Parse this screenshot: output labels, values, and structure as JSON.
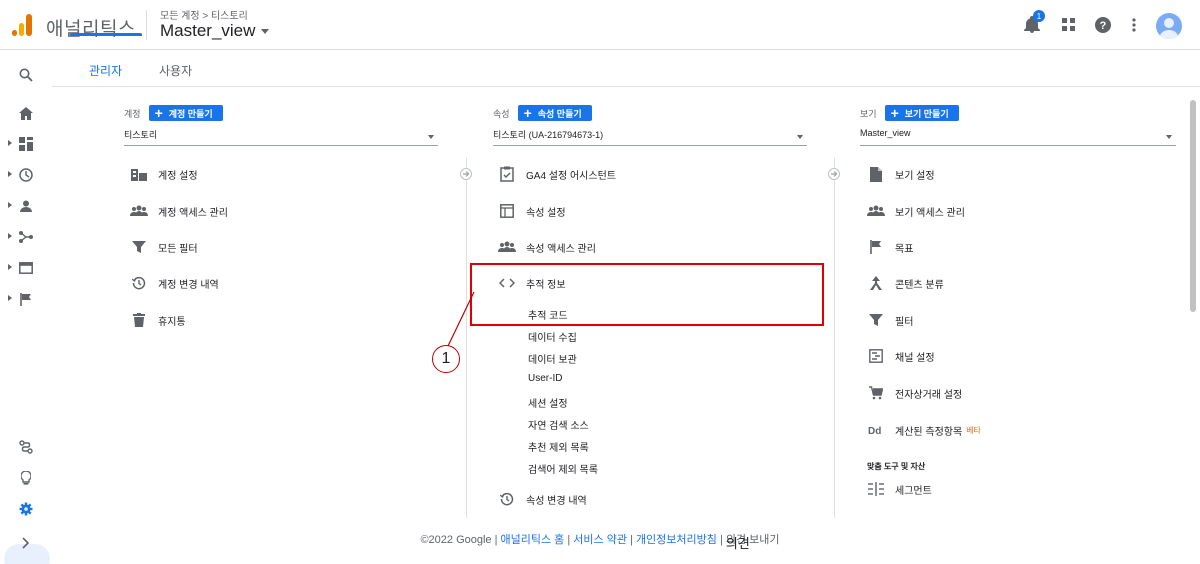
{
  "header": {
    "app_name": "애널리틱스",
    "breadcrumb": "모든 계정 > 티스토리",
    "view_name": "Master_view",
    "notification_count": "1"
  },
  "tabs": [
    {
      "label": "관리자",
      "active": true
    },
    {
      "label": "사용자",
      "active": false
    }
  ],
  "account_col": {
    "label": "계정",
    "create_label": "계정 만들기",
    "dropdown_value": "티스토리",
    "items": [
      {
        "label": "계정 설정",
        "icon": "building-icon"
      },
      {
        "label": "계정 액세스 관리",
        "icon": "people-icon"
      },
      {
        "label": "모든 필터",
        "icon": "filter-icon"
      },
      {
        "label": "계정 변경 내역",
        "icon": "history-icon"
      },
      {
        "label": "휴지통",
        "icon": "trash-icon"
      }
    ]
  },
  "property_col": {
    "label": "속성",
    "create_label": "속성 만들기",
    "dropdown_value": "티스토리 (UA-216794673-1)",
    "items": [
      {
        "label": "GA4 설정 어시스턴트",
        "icon": "checklist-icon"
      },
      {
        "label": "속성 설정",
        "icon": "layout-icon"
      },
      {
        "label": "속성 액세스 관리",
        "icon": "people-icon"
      },
      {
        "label": "추적 정보",
        "icon": "code-icon"
      }
    ],
    "tracking_sub": [
      "추적 코드",
      "데이터 수집",
      "데이터 보관",
      "User-ID",
      "세션 설정",
      "자연 검색 소스",
      "추천 제외 목록",
      "검색어 제외 목록"
    ],
    "change_history": "속성 변경 내역"
  },
  "view_col": {
    "label": "보기",
    "create_label": "보기 만들기",
    "dropdown_value": "Master_view",
    "items": [
      {
        "label": "보기 설정",
        "icon": "document-icon"
      },
      {
        "label": "보기 액세스 관리",
        "icon": "people-icon"
      },
      {
        "label": "목표",
        "icon": "flag-icon"
      },
      {
        "label": "콘텐츠 분류",
        "icon": "grouping-icon"
      },
      {
        "label": "필터",
        "icon": "filter-icon"
      },
      {
        "label": "채널 설정",
        "icon": "channel-icon"
      },
      {
        "label": "전자상거래 설정",
        "icon": "cart-icon"
      },
      {
        "label": "계산된 측정항목",
        "icon": "dd-icon",
        "badge": "베타"
      }
    ],
    "section_title": "맞춤 도구 및 자산",
    "segment_label": "세그먼트"
  },
  "annotation": {
    "number": "1"
  },
  "footer": {
    "copyright": "©2022 Google",
    "links": [
      "애널리틱스 홈",
      "서비스 약관",
      "개인정보처리방침"
    ],
    "feedback": "의견 보내기",
    "overlay": "의견",
    "sep": " | "
  },
  "colors": {
    "accent": "#1a73e8",
    "highlight": "#e00000"
  }
}
